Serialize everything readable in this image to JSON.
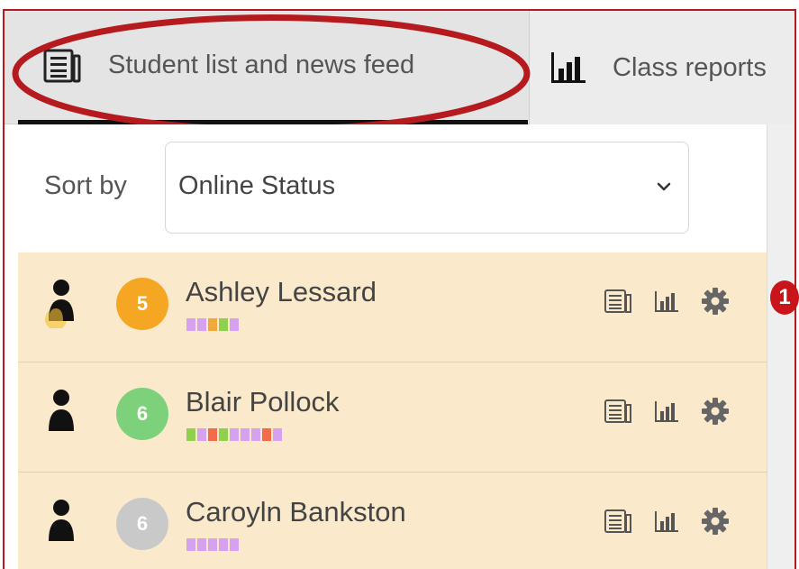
{
  "tabs": [
    {
      "label": "Student list and news feed",
      "icon": "news-feed-icon",
      "active": true
    },
    {
      "label": "Class reports",
      "icon": "bar-chart-icon",
      "active": false
    }
  ],
  "sort": {
    "label": "Sort by",
    "value": "Online Status"
  },
  "students": [
    {
      "name": "Ashley Lessard",
      "level": "5",
      "badge_color": "#f5a623",
      "online": "idle",
      "progress": [
        "#d6a2f0",
        "#d6a2f0",
        "#f2a93b",
        "#8fd04f",
        "#d6a2f0"
      ]
    },
    {
      "name": "Blair Pollock",
      "level": "6",
      "badge_color": "#7ed17b",
      "online": "offline",
      "progress": [
        "#8fd04f",
        "#d6a2f0",
        "#f26b4b",
        "#8fd04f",
        "#d6a2f0",
        "#d6a2f0",
        "#d6a2f0",
        "#f26b4b",
        "#d6a2f0"
      ]
    },
    {
      "name": "Caroyln Bankston",
      "level": "6",
      "badge_color": "#c9c9c9",
      "online": "offline",
      "progress": [
        "#d6a2f0",
        "#d6a2f0",
        "#d6a2f0",
        "#d6a2f0",
        "#d6a2f0"
      ]
    }
  ],
  "callout": {
    "number": "1"
  },
  "colors": {
    "highlight": "#b51a1f",
    "row_bg": "#fbe9cc",
    "accent_red": "#c9141b"
  }
}
